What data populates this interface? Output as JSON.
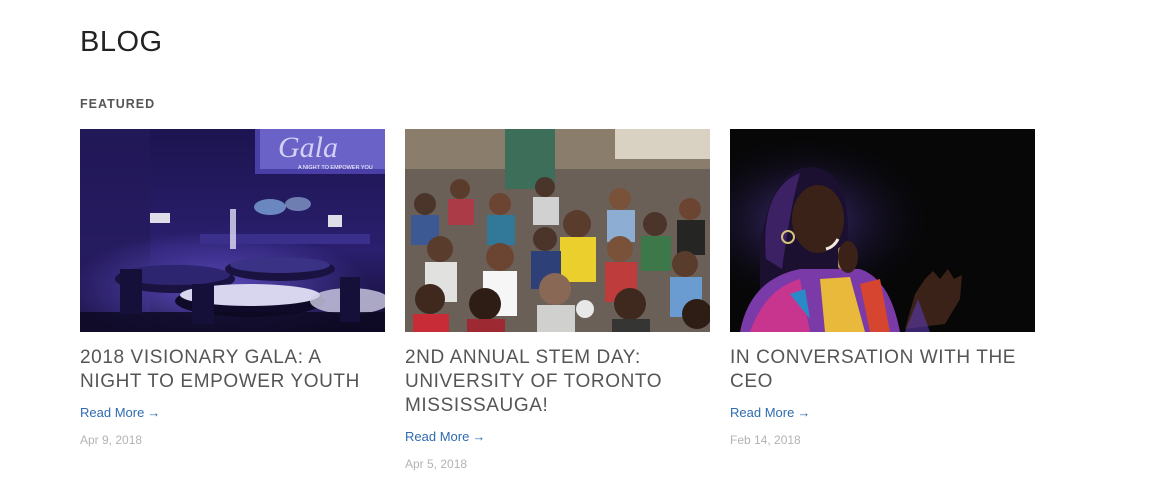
{
  "page": {
    "title": "BLOG",
    "section_label": "FEATURED"
  },
  "posts": [
    {
      "title": "2018 VISIONARY GALA: A NIGHT TO EMPOWER YOUTH",
      "read_more": "Read More",
      "arrow": "→",
      "date": "Apr 9, 2018",
      "image": {
        "subject": "gala-banquet-hall",
        "banner_text": "A NIGHT TO EMPOWER YOU"
      }
    },
    {
      "title": "2ND ANNUAL STEM DAY: UNIVERSITY OF TORONTO MISSISSAUGA!",
      "read_more": "Read More",
      "arrow": "→",
      "date": "Apr 5, 2018",
      "image": {
        "subject": "students-audience"
      }
    },
    {
      "title": "IN CONVERSATION WITH THE CEO",
      "read_more": "Read More",
      "arrow": "→",
      "date": "Feb 14, 2018",
      "image": {
        "subject": "speaker-on-stage"
      }
    }
  ],
  "colors": {
    "link": "#2e6bb0",
    "heading": "#555555",
    "date": "#b3b3b3"
  }
}
